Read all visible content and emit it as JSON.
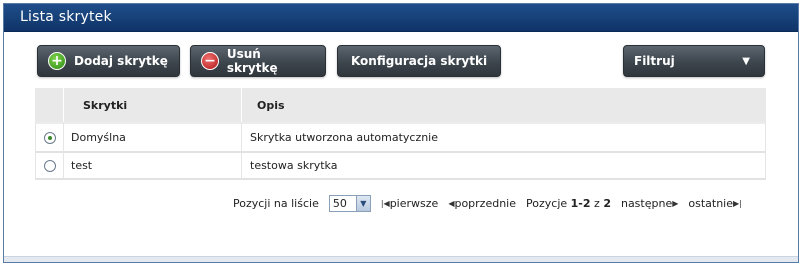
{
  "panel": {
    "title": "Lista skrytek"
  },
  "toolbar": {
    "add_label": "Dodaj skrytkę",
    "add_icon": "plus-circle-icon",
    "delete_label": "Usuń skrytkę",
    "delete_icon": "minus-circle-icon",
    "config_label": "Konfiguracja skrytki",
    "filter_label": "Filtruj",
    "filter_icon": "chevron-down-icon"
  },
  "table": {
    "columns": [
      "",
      "Skrytki",
      "Opis"
    ],
    "rows": [
      {
        "selected": true,
        "name": "Domyślna",
        "description": "Skrytka utworzona automatycznie"
      },
      {
        "selected": false,
        "name": "test",
        "description": "testowa skrytka"
      }
    ]
  },
  "pager": {
    "per_page_label": "Pozycji na liście",
    "per_page_value": "50",
    "first_label": "pierwsze",
    "prev_label": "poprzednie",
    "position_label": "Pozycje",
    "range": "1-2",
    "of_label": "z",
    "total": "2",
    "next_label": "następne",
    "last_label": "ostatnie"
  },
  "colors": {
    "header_bg": "#1f4e8a",
    "button_bg": "#3d454d",
    "add_icon": "#2f8a14",
    "delete_icon": "#b01818"
  }
}
